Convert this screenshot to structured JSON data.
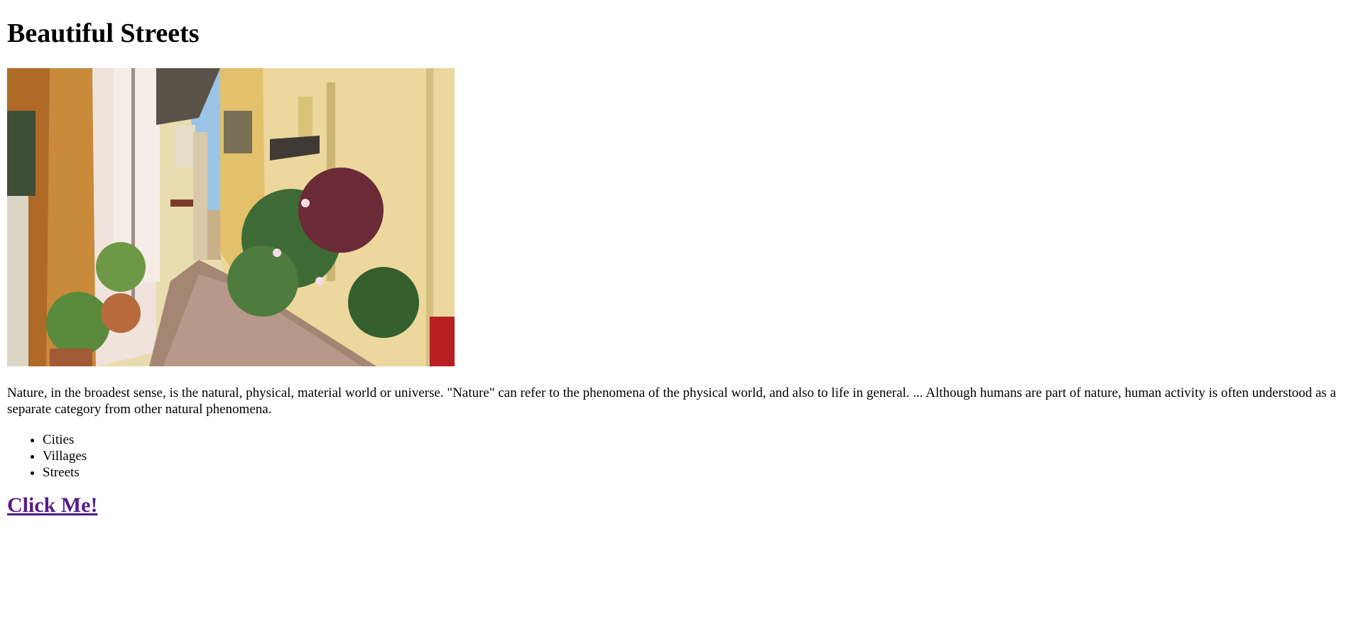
{
  "page": {
    "title": "Beautiful Streets",
    "image_alt": "street-photo",
    "paragraph": "Nature, in the broadest sense, is the natural, physical, material world or universe. \"Nature\" can refer to the phenomena of the physical world, and also to life in general. ... Although humans are part of nature, human activity is often understood as a separate category from other natural phenomena.",
    "list": [
      "Cities",
      "Villages",
      "Streets"
    ],
    "link_label": "Click Me!"
  },
  "colors": {
    "link_visited": "#551a8b",
    "text": "#000000",
    "background": "#ffffff"
  }
}
